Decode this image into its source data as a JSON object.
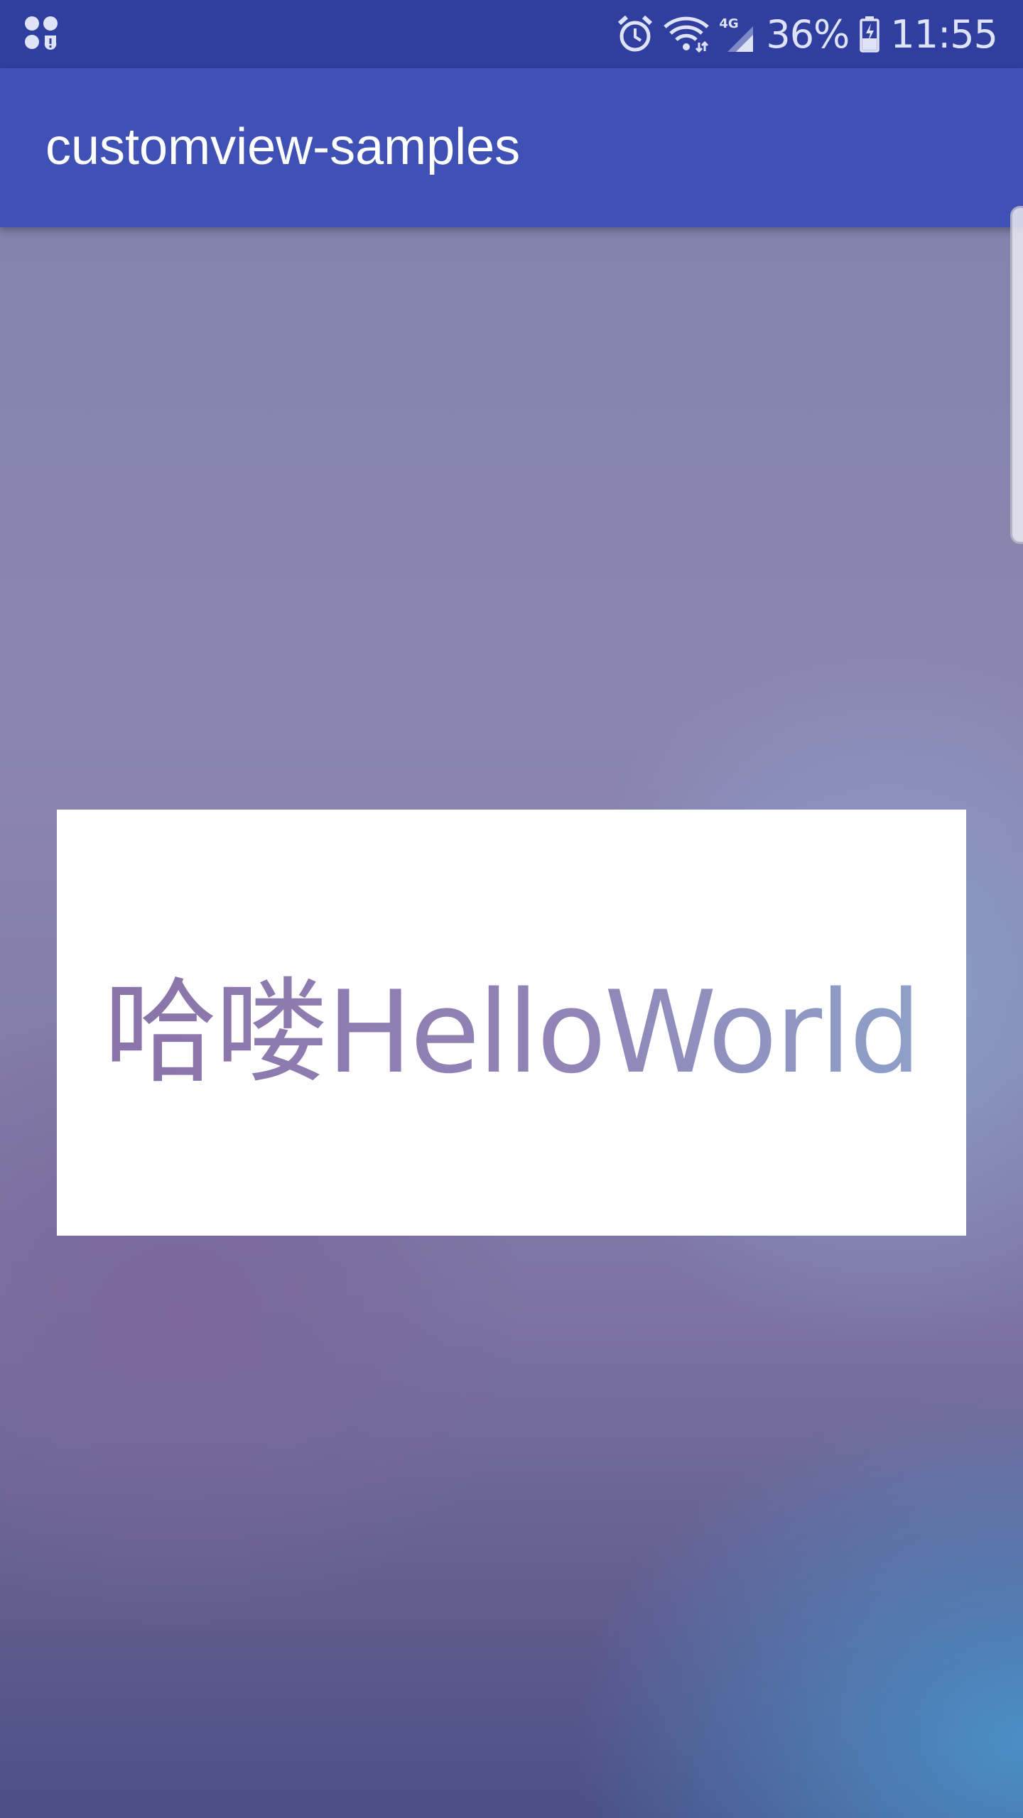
{
  "status_bar": {
    "left_icon": "notification-grid-icon",
    "alarm_icon": "alarm-clock-icon",
    "wifi_icon": "wifi-icon",
    "network_label": "4G",
    "signal_icon": "cell-signal-icon",
    "battery_percent": "36%",
    "battery_icon": "battery-charging-icon",
    "time": "11:55"
  },
  "app_bar": {
    "title": "customview-samples",
    "background_color": "#3f51b5",
    "status_color": "#303f9f"
  },
  "main": {
    "custom_view_text": "哈喽HelloWorld",
    "card_color": "#ffffff"
  }
}
